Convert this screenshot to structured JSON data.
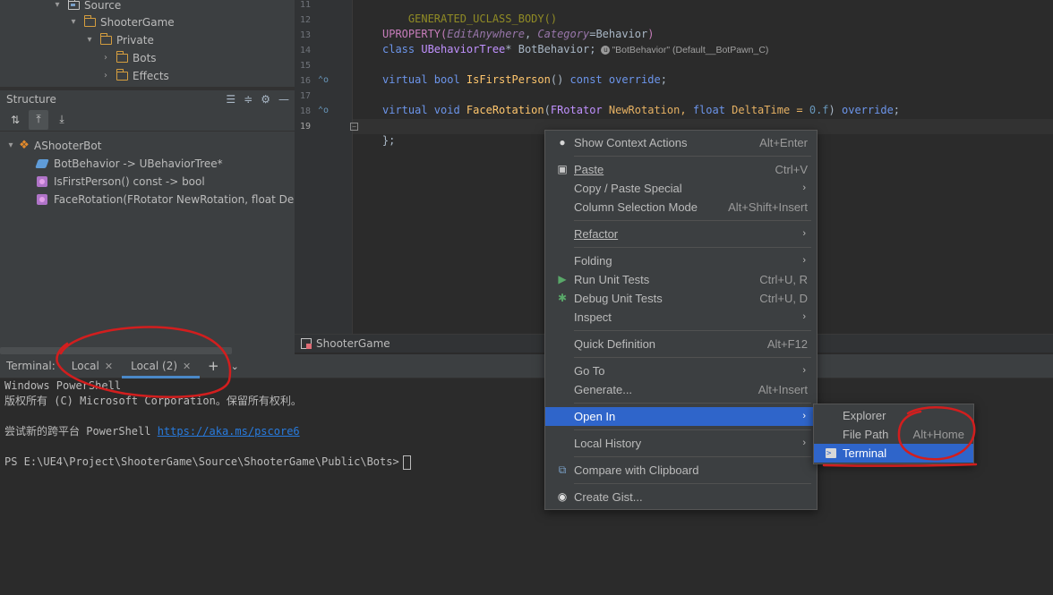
{
  "project_tree": {
    "items": [
      {
        "label": "Source"
      },
      {
        "label": "ShooterGame"
      },
      {
        "label": "Private"
      },
      {
        "label": "Bots"
      },
      {
        "label": "Effects"
      }
    ]
  },
  "structure": {
    "title": "Structure",
    "root": "AShooterBot",
    "members": [
      {
        "label": "BotBehavior -> UBehaviorTree*",
        "kind": "field"
      },
      {
        "label": "IsFirstPerson() const -> bool",
        "kind": "method"
      },
      {
        "label": "FaceRotation(FRotator NewRotation, float Delta",
        "kind": "method"
      }
    ]
  },
  "editor": {
    "line_numbers": [
      "11",
      "12",
      "13",
      "14",
      "15",
      "16",
      "17",
      "18",
      "19"
    ],
    "lines": {
      "l11": "GENERATED_UCLASS_BODY()",
      "l13_macro": "UPROPERTY(",
      "l13_p1": "EditAnywhere",
      "l13_sep": ", ",
      "l13_p2": "Category",
      "l13_eq": "=",
      "l13_val": "Behavior",
      "l13_end": ")",
      "l14_kw": "class ",
      "l14_type": "UBehaviorTree",
      "l14_rest": "* BotBehavior;",
      "l14_hint": "\"BotBehavior\" (Default__BotPawn_C)",
      "l16_kw": "virtual bool ",
      "l16_fn": "IsFirstPerson",
      "l16_rest": "() ",
      "l16_kw2": "const override",
      "l16_end": ";",
      "l18_kw": "virtual void ",
      "l18_fn": "FaceRotation",
      "l18_open": "(",
      "l18_t1": "FRotator",
      "l18_p1": " NewRotation, ",
      "l18_t2": "float",
      "l18_p2": " DeltaTime = ",
      "l18_num": "0.f",
      "l18_close": ") ",
      "l18_kw2": "override",
      "l18_end": ";",
      "l19": "};"
    },
    "breadcrumb": "ShooterGame"
  },
  "terminal": {
    "title": "Terminal:",
    "tabs": [
      {
        "label": "Local"
      },
      {
        "label": "Local (2)"
      }
    ],
    "output": [
      "Windows PowerShell",
      "版权所有 (C) Microsoft Corporation。保留所有权利。",
      "",
      "尝试新的跨平台 PowerShell ",
      "",
      "PS E:\\UE4\\Project\\ShooterGame\\Source\\ShooterGame\\Public\\Bots>"
    ],
    "link": "https://aka.ms/pscore6"
  },
  "context_menu": {
    "items": [
      {
        "label": "Show Context Actions",
        "shortcut": "Alt+Enter",
        "icon": "bulb-icon"
      },
      {
        "label": "Paste",
        "shortcut": "Ctrl+V",
        "icon": "clipboard-icon"
      },
      {
        "label": "Copy / Paste Special",
        "submenu": true
      },
      {
        "label": "Column Selection Mode",
        "shortcut": "Alt+Shift+Insert"
      },
      {
        "label": "Refactor",
        "submenu": true
      },
      {
        "label": "Folding",
        "submenu": true
      },
      {
        "label": "Run Unit Tests",
        "shortcut": "Ctrl+U, R",
        "icon": "run-icon"
      },
      {
        "label": "Debug Unit Tests",
        "shortcut": "Ctrl+U, D",
        "icon": "bug-icon"
      },
      {
        "label": "Inspect",
        "submenu": true
      },
      {
        "label": "Quick Definition",
        "shortcut": "Alt+F12"
      },
      {
        "label": "Go To",
        "submenu": true
      },
      {
        "label": "Generate...",
        "shortcut": "Alt+Insert"
      },
      {
        "label": "Open In",
        "submenu": true,
        "selected": true
      },
      {
        "label": "Local History",
        "submenu": true
      },
      {
        "label": "Compare with Clipboard",
        "icon": "compare-icon"
      },
      {
        "label": "Create Gist...",
        "icon": "github-icon"
      }
    ]
  },
  "submenu": {
    "items": [
      {
        "label": "Explorer"
      },
      {
        "label": "File Path",
        "shortcut": "Alt+Home"
      },
      {
        "label": "Terminal",
        "selected": true
      }
    ]
  },
  "colors": {
    "selection": "#2f65ca",
    "annotation": "#d21e1e",
    "panel": "#3c3f41",
    "editor_bg": "#2b2b2b"
  }
}
